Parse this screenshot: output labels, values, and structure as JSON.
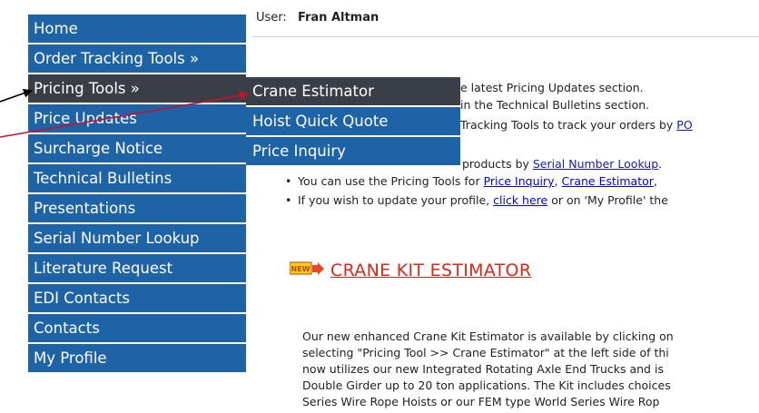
{
  "user": {
    "label": "User:",
    "name": "Fran Altman"
  },
  "nav": {
    "items": [
      {
        "label": "Home"
      },
      {
        "label": "Order Tracking Tools »"
      },
      {
        "label": "Pricing Tools »"
      },
      {
        "label": "Price Updates"
      },
      {
        "label": "Surcharge Notice"
      },
      {
        "label": "Technical Bulletins"
      },
      {
        "label": "Presentations"
      },
      {
        "label": "Serial Number Lookup"
      },
      {
        "label": "Literature Request"
      },
      {
        "label": "EDI Contacts"
      },
      {
        "label": "Contacts"
      },
      {
        "label": "My Profile"
      }
    ],
    "active_index": 2
  },
  "flyout": {
    "items": [
      {
        "label": "Crane Estimator"
      },
      {
        "label": "Hoist Quick Quote"
      },
      {
        "label": "Price Inquiry"
      }
    ],
    "active_index": 0
  },
  "content": {
    "line1": "e latest Pricing Updates section.",
    "line2": "in the Technical Bulletins section.",
    "line3_text": "Tracking Tools to track your orders by ",
    "line3_link": "PO",
    "line4_text": "products by ",
    "line4_link": "Serial Number Lookup",
    "line4_end": ".",
    "bullet1_text": "You can use the Pricing Tools for ",
    "bullet1_link1": "Price Inquiry",
    "bullet1_sep": ", ",
    "bullet1_link2": "Crane Estimator",
    "bullet1_end": ",",
    "bullet2_text": "If you wish to update your profile, ",
    "bullet2_link": "click here",
    "bullet2_end": " or on 'My Profile' the",
    "new_badge": "NEW",
    "kit_title": "CRANE KIT ESTIMATOR",
    "para_lines": [
      "Our new enhanced Crane Kit Estimator is available by clicking on",
      "selecting \"Pricing Tool >> Crane Estimator\" at the left side of thi",
      "now utilizes our new Integrated Rotating Axle End Trucks and is",
      "Double Girder up to 20 ton applications. The Kit includes choices",
      "Series Wire Rope Hoists or our FEM type World Series Wire Rop"
    ]
  },
  "colors": {
    "nav_bg": "#1f63a7",
    "nav_active": "#3a3f47",
    "arrow": "#c8102e",
    "title": "#d7281c"
  }
}
